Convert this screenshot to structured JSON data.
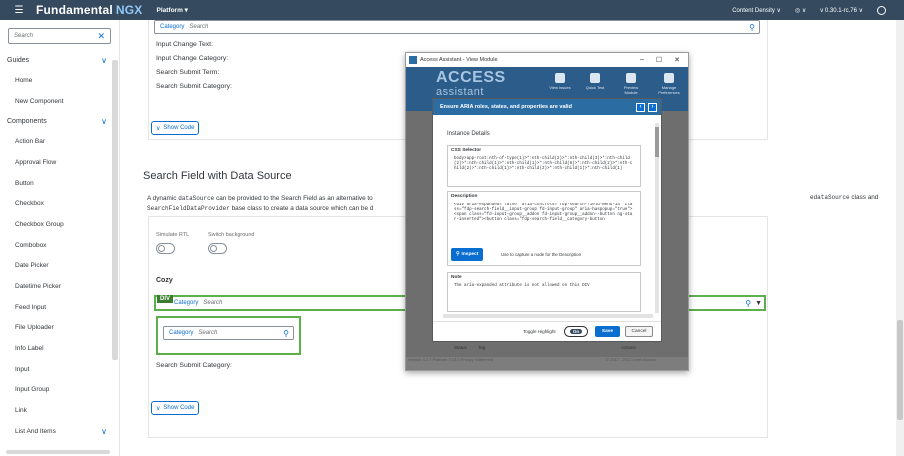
{
  "shell": {
    "brand_main": "Fundamental",
    "brand_accent": "NGX",
    "product": "Platform ▾",
    "content_density": "Content Density",
    "version": "v 0.30.1-rc.76"
  },
  "sidebar": {
    "search_placeholder": "Search",
    "groups": [
      {
        "label": "Guides",
        "items": [
          "Home",
          "New Component"
        ]
      },
      {
        "label": "Components",
        "items": [
          "Action Bar",
          "Approval Flow",
          "Button",
          "Checkbox",
          "Checkbox Group",
          "Combobox",
          "Date Picker",
          "Datetime Picker",
          "Feed Input",
          "File Uploader",
          "Info Label",
          "Input",
          "Input Group",
          "Link",
          "List And Items"
        ]
      }
    ]
  },
  "main": {
    "top_search": {
      "category": "Category",
      "placeholder": "Search"
    },
    "fields": [
      "Input Change Text:",
      "Input Change Category:",
      "Search Submit Term:",
      "Search Submit Category:"
    ],
    "show_code": "Show Code",
    "section_title": "Search Field with Data Source",
    "desc_a": "A dynamic",
    "desc_code1": "dataSource",
    "desc_b": "can be provided to the Search Field as an alternative to",
    "desc_code2": "SearchFieldDataProvider",
    "desc_c": "base class to create a data source which can be d",
    "desc_right": "e",
    "desc_right_code": "dataSource",
    "desc_right_end": "class and",
    "simulate_rtl": "Simulate RTL",
    "switch_bg": "Switch background",
    "cozy": "Cozy",
    "div_tag": "DIV",
    "hl_search": {
      "category": "Category",
      "placeholder": "Search"
    },
    "cozy_search": {
      "category": "Category",
      "placeholder": "Search"
    },
    "submit_category": "Search Submit Category:",
    "show_code_2": "Show Code"
  },
  "modal": {
    "window_title": "Access Assistant - View Module",
    "logo_line1": "ACCESS",
    "logo_line2": "assistant",
    "tools": [
      "View Issues",
      "Quick Test",
      "Preview Module",
      "Manage Preferences"
    ],
    "bg_rows": [
      "Status",
      "Tag",
      "Actions"
    ],
    "footer": "Version 4.0.7   Platform 3.13.0   Privacy Statement",
    "footer_right": "© 2017 - 2021 Level Access",
    "dialog": {
      "title": "Ensure ARIA roles, states, and properties are valid",
      "subtitle": "Instance Details",
      "css_label": "CSS Selector",
      "css_value": "body>app-root:nth-of-type(1)>*:nth-child(2)>*:nth-child(3)>*:nth-child(2)>*:nth-child(1)>*:nth-child(1)>*:nth-child(8)>*:nth-child(2)>*:nth-child(2)>*:nth-child(1)>*:nth-child(2)>*:nth-child(1)>*:nth-child(1)",
      "desc_label": "Description",
      "desc_value": "<div aria-expanded=\"false\" aria-controls=\"fdp-search-field-menu-14\" class=\"fdp-search-field__input-group fd-input-group\" aria-haspopup=\"true\"><span class=\"fd-input-group__addon fd-input-group__addon--button ng-star-inserted\"><button class=\"fdp-search-field__category-button",
      "inspect": "Inspect",
      "inspect_hint": "Use to capture a node for the Description",
      "note_label": "Note",
      "note_value": "The aria-expanded attribute is not allowed on this DIV",
      "toggle_highlight": "Toggle Highlight",
      "toggle_state": "On",
      "save": "Save",
      "cancel": "Cancel"
    }
  },
  "colors": {
    "shell": "#354a5f",
    "accent": "#0a6ed1",
    "highlight": "#5bb04b",
    "dialog_header": "#2b6ca3"
  }
}
